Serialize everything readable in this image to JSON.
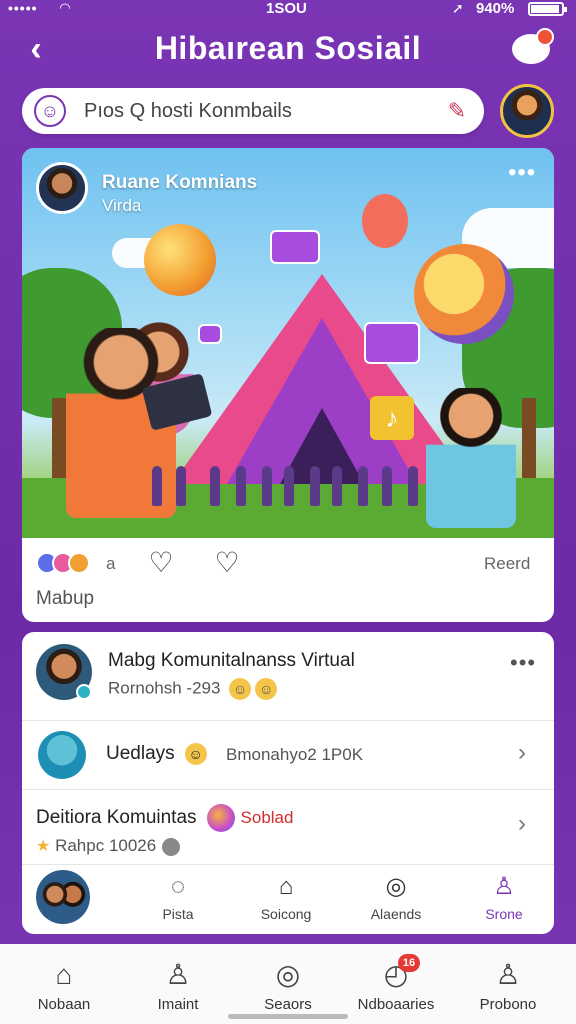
{
  "status_bar": {
    "signal": "•••••",
    "time": "1SOU",
    "battery_text": "940%",
    "icons": [
      "signal-icon",
      "wifi-icon",
      "location-icon",
      "battery-icon"
    ]
  },
  "header": {
    "title": "Hibaırean Sosiail",
    "back_icon": "back-arrow-icon",
    "chat_icon": "chat-bubble-icon"
  },
  "search": {
    "value": "Pıos Q hosti Konmbails",
    "leading_icon": "smile-icon",
    "trailing_icon": "brand-logo-icon"
  },
  "post": {
    "author_name": "Ruane Komnians",
    "author_sub": "Virda",
    "reactions_label": "a",
    "read_label": "Reerd",
    "caption": "Mabup",
    "image_icons": [
      "music-note-icon",
      "heart-icon",
      "star-icon"
    ]
  },
  "list": {
    "row1": {
      "title": "Mabg Komunitalnanss Virtual",
      "subtitle": "Rornohsh -293 "
    },
    "row2": {
      "title": "Uedlays",
      "subtitle": "Bmonahyo2 1P0K"
    },
    "row3": {
      "title": "Deitiora Komuintas",
      "tag": "Soblad",
      "subtitle": "Rahpc 10026"
    }
  },
  "mini_nav": {
    "items": [
      {
        "label": "Pista",
        "icon": "chat-icon"
      },
      {
        "label": "Soicong",
        "icon": "inbox-icon"
      },
      {
        "label": "Alaends",
        "icon": "compass-icon"
      },
      {
        "label": "Srone",
        "icon": "person-icon"
      }
    ]
  },
  "bottom_nav": {
    "items": [
      {
        "label": "Nobaan",
        "icon": "home-icon"
      },
      {
        "label": "Imaint",
        "icon": "people-icon"
      },
      {
        "label": "Seaors",
        "icon": "trend-icon"
      },
      {
        "label": "Ndboaaries",
        "icon": "notifications-icon",
        "badge": "16"
      },
      {
        "label": "Probono",
        "icon": "profile-icon"
      }
    ]
  },
  "colors": {
    "brand_purple": "#7a35b5",
    "accent_red": "#e53935",
    "accent_teal": "#2bb3c4"
  }
}
